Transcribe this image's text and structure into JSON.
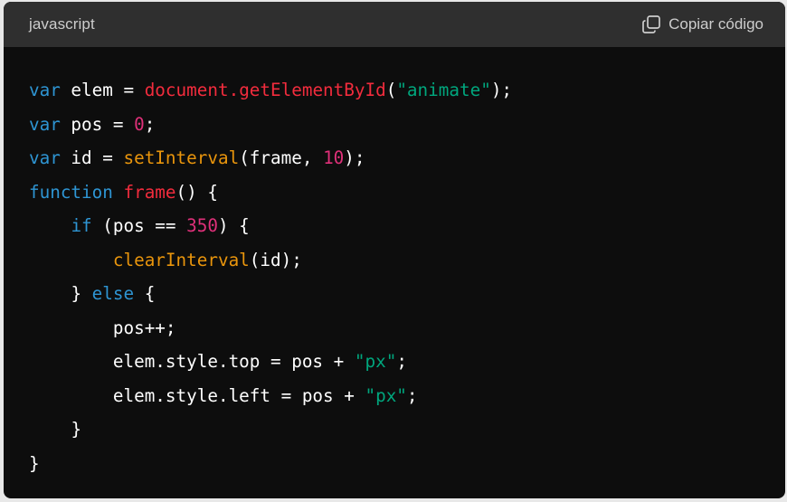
{
  "header": {
    "language": "javascript",
    "copy_label": "Copiar código",
    "copy_icon": "copy-icon"
  },
  "colors": {
    "header_bg": "#2f2f2f",
    "code_bg": "#0d0d0d",
    "keyword": "#2e95d3",
    "string": "#00a67d",
    "number": "#df3079",
    "function_call": "#e9950c",
    "property": "#df3079",
    "plain": "#ffffff"
  },
  "code": {
    "line1": {
      "kw": "var",
      "rest1": " elem = ",
      "obj": "document",
      "dot": ".",
      "meth": "getElementById",
      "open": "(",
      "str": "\"animate\"",
      "close": ");"
    },
    "line2": {
      "kw": "var",
      "rest1": " pos = ",
      "num": "0",
      "close": ";"
    },
    "line3": {
      "kw": "var",
      "rest1": " id = ",
      "meth": "setInterval",
      "mid": "(frame, ",
      "num": "10",
      "close": ");"
    },
    "line4": {
      "kw": "function",
      "sp": " ",
      "name": "frame",
      "close": "() {"
    },
    "line5": {
      "indent": "    ",
      "kw": "if",
      "mid": " (pos == ",
      "num": "350",
      "close": ") {"
    },
    "line6": {
      "indent": "        ",
      "meth": "clearInterval",
      "close": "(id);"
    },
    "line7": {
      "indent": "    ",
      "open": "} ",
      "kw": "else",
      "close": " {"
    },
    "line8": {
      "indent": "        ",
      "text": "pos++;"
    },
    "line9": {
      "indent": "        ",
      "text": "elem.style.top = pos + ",
      "str": "\"px\"",
      "close": ";"
    },
    "line10": {
      "indent": "        ",
      "text": "elem.style.left = pos + ",
      "str": "\"px\"",
      "close": ";"
    },
    "line11": {
      "indent": "    ",
      "text": "}"
    },
    "line12": {
      "text": "}"
    }
  }
}
